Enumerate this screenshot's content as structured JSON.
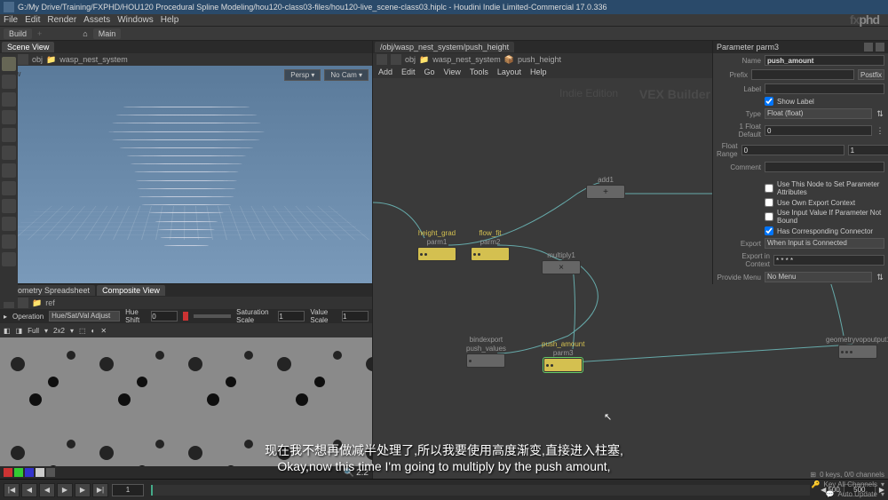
{
  "title_bar": "G:/My Drive/Training/FXPHD/HOU120 Procedural Spline Modeling/hou120-class03-files/hou120-live_scene-class03.hiplc - Houdini Indie Limited-Commercial 17.0.336",
  "main_menu": [
    "File",
    "Edit",
    "Render",
    "Assets",
    "Windows",
    "Help"
  ],
  "shelf": {
    "build": "Build",
    "main": "Main"
  },
  "left": {
    "tabs": [
      "Scene View"
    ],
    "path": {
      "obj": "obj",
      "node": "wasp_nest_system"
    },
    "viewport": {
      "label": "View",
      "persp": "Persp",
      "cam": "No Cam"
    },
    "spreadsheet": {
      "tabs": [
        "Geometry Spreadsheet",
        "Composite View"
      ],
      "ref": "ref",
      "op_label": "Operation",
      "op_value": "Hue/Sat/Val Adjust",
      "hue_label": "Hue Shift",
      "hue_value": "0",
      "sat_label": "Saturation Scale",
      "sat_value": "1",
      "val_label": "Value Scale",
      "val_value": "1",
      "full": "Full",
      "res": "2x2",
      "zoom": "2.2"
    }
  },
  "right": {
    "path_full": "/obj/wasp_nest_system/push_height",
    "path": {
      "obj": "obj",
      "n1": "wasp_nest_system",
      "n2": "push_height"
    },
    "menu": [
      "Add",
      "Edit",
      "Go",
      "View",
      "Tools",
      "Layout",
      "Help"
    ],
    "watermark1": "Indie Edition",
    "watermark2": "VEX Builder",
    "nodes": {
      "height_grad": {
        "label1": "height_grad",
        "label2": "parm1"
      },
      "flow": {
        "label1": "flow_fit",
        "label2": "parm2"
      },
      "add1": "add1",
      "multiply1": "multiply1",
      "bind": {
        "label1": "bindexport",
        "label2": "push_values"
      },
      "push_amount": {
        "label1": "push_amount",
        "label2": "parm3"
      },
      "output": "geometryvopoutput1"
    }
  },
  "params": {
    "header": "Parameter  parm3",
    "name_label": "Name",
    "name_value": "push_amount",
    "prefix_label": "Prefix",
    "postfix_btn": "Postfix",
    "label_label": "Label",
    "show_label": "Show Label",
    "type_label": "Type",
    "type_value": "Float (float)",
    "float_default_label": "1 Float Default",
    "float_default_value": "0",
    "float_range_label": "Float Range",
    "range_min": "0",
    "range_max": "1",
    "comment_label": "Comment",
    "chk1": "Use This Node to Set Parameter Attributes",
    "chk2": "Use Own Export Context",
    "chk3": "Use Input Value If Parameter Not Bound",
    "chk4": "Has Corresponding Connector",
    "export_label": "Export",
    "export_value": "When Input is Connected",
    "export_ctx_label": "Export in Context",
    "menu_label": "Provide Menu",
    "menu_value": "No Menu"
  },
  "playbar": {
    "frame": "1",
    "range_start": "1",
    "range_end": "500",
    "total": "500"
  },
  "status": {
    "keys": "0 keys, 0/0 channels",
    "key_all": "Key All Channels",
    "auto": "Auto Update"
  },
  "subtitles": {
    "cn": "现在我不想再做减半处理了,所以我要使用高度渐变,直接进入柱塞,",
    "en": "Okay,now this time I'm going to multiply by the push amount,"
  },
  "logo": {
    "fx": "fx",
    "phd": "phd"
  }
}
